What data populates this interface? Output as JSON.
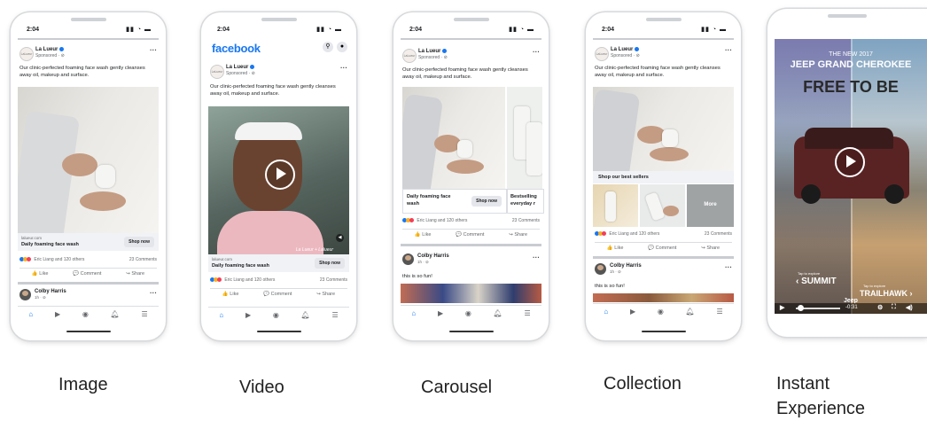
{
  "status_time": "2:04",
  "facebook_logo": "facebook",
  "brand": {
    "name": "La Lueur",
    "sponsored": "Sponsored · ⊘",
    "logo_text": "LaLueur"
  },
  "caption": "Our clinic-perfected foaming face wash gently cleanses away oil, makeup and surface.",
  "image_ad": {
    "url": "lalueur.com",
    "title": "Daily foaming face wash",
    "cta": "Shop now"
  },
  "video_ad": {
    "url": "lalueur.com",
    "title": "Daily foaming face wash",
    "cta": "Shop now",
    "watermark": "La Lueur + Lalueur"
  },
  "carousel_ad": {
    "cards": [
      {
        "title": "Daily foaming face wash",
        "cta": "Shop now"
      },
      {
        "title": "Bestselling everyday r"
      }
    ]
  },
  "collection_ad": {
    "heading": "Shop our best sellers",
    "more_label": "More"
  },
  "reactions_text": "Eric Liang and 120 others",
  "comments_text": "23 Comments",
  "actions": {
    "like": "Like",
    "comment": "Comment",
    "share": "Share"
  },
  "commenter": {
    "name": "Colby Harris",
    "time": "1h · ⊘",
    "comment": "this is so fun!"
  },
  "instant_experience": {
    "headline_small": "THE NEW 2017",
    "headline_brand": "JEEP GRAND CHEROKEE",
    "slogan": "FREE TO BE",
    "left_hint": "Tap to explore",
    "left_label": "SUMMIT",
    "right_hint": "Tap to explore",
    "right_label": "TRAILHAWK",
    "brand_footer": "Jeep",
    "time": "-0:31"
  },
  "labels": [
    "Image",
    "Video",
    "Carousel",
    "Collection",
    "Instant",
    "Experience"
  ],
  "colors": {
    "facebook_blue": "#1877f2",
    "like": "#1877f2",
    "love": "#f33e58",
    "haha": "#f7b125"
  },
  "icons": [
    "home-icon",
    "watch-icon",
    "groups-icon",
    "bell-icon",
    "menu-icon",
    "search-icon",
    "messenger-icon",
    "play-icon"
  ]
}
